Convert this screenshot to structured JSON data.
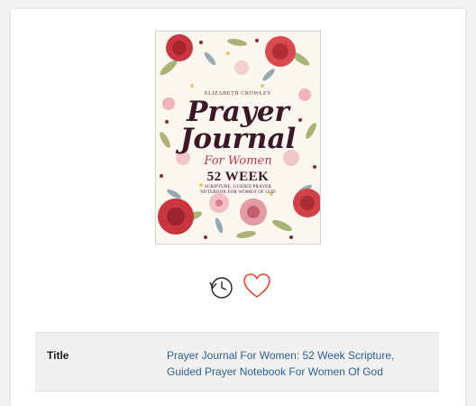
{
  "book": {
    "cover": {
      "author": "ELIZABETH CROWLEY",
      "title_line1": "Prayer",
      "title_line2": "Journal",
      "subtitle": "For Women",
      "week": "52 WEEK",
      "tagline_line1": "SCRIPTURE, GUIDED PRAYER",
      "tagline_line2": "NOTEBOOK FOR WOMEN OF GOD"
    }
  },
  "actions": {
    "history_icon": "history-clock-icon",
    "favorite_icon": "heart-outline-icon",
    "favorite_color": "#e2442f"
  },
  "details": {
    "label": "Title",
    "value_line1": "Prayer Journal For Women: 52 Week Scripture,",
    "value_line2": "Guided Prayer Notebook For Women Of God"
  }
}
